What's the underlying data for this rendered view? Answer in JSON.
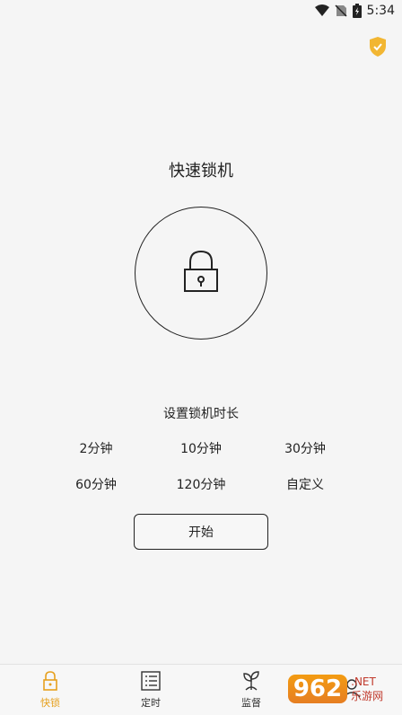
{
  "status": {
    "time": "5:34"
  },
  "main": {
    "title": "快速锁机",
    "duration_title": "设置锁机时长",
    "options": [
      "2分钟",
      "10分钟",
      "30分钟",
      "60分钟",
      "120分钟",
      "自定义"
    ],
    "start_label": "开始"
  },
  "nav": {
    "items": [
      {
        "label": "快锁",
        "icon": "lock-icon"
      },
      {
        "label": "定时",
        "icon": "schedule-list-icon"
      },
      {
        "label": "监督",
        "icon": "sprout-icon"
      },
      {
        "label": "",
        "icon": "profile-icon"
      }
    ]
  },
  "watermark": {
    "logo": "962",
    "text1": ".NET",
    "text2": "乐游网"
  },
  "colors": {
    "accent": "#e6a01e",
    "background": "#f5f5f5"
  }
}
